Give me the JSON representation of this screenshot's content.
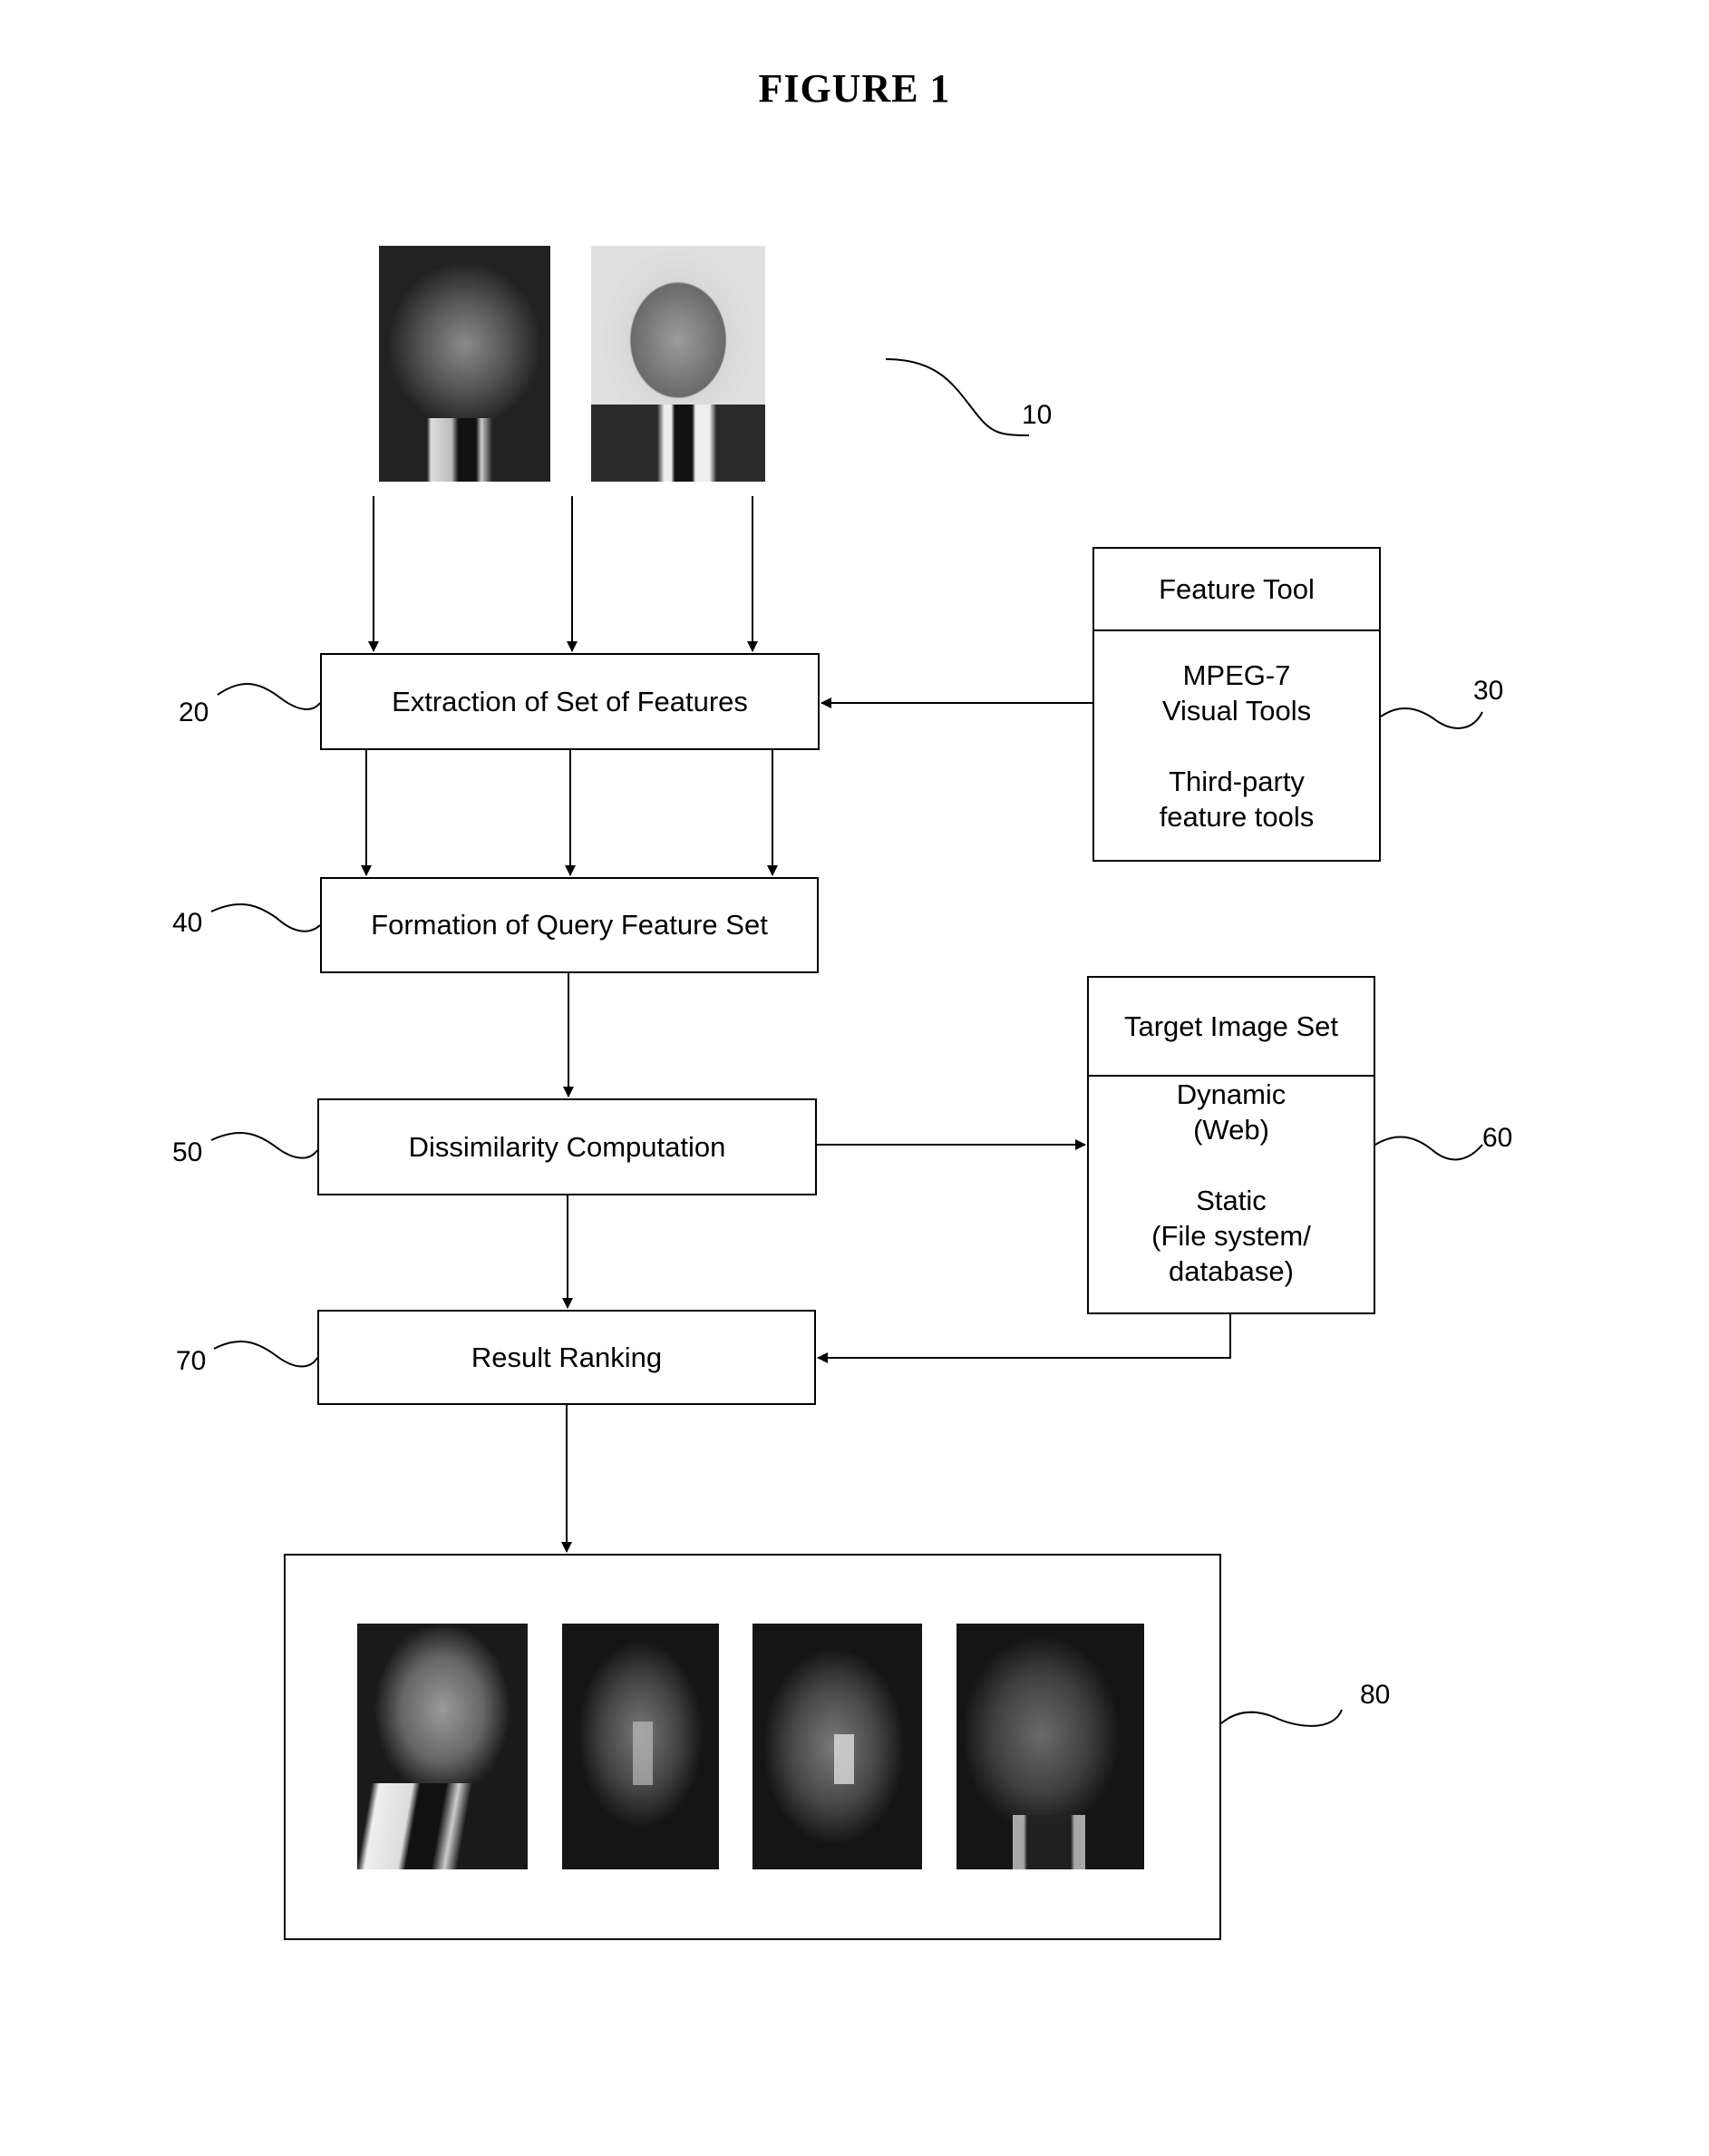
{
  "figure": {
    "title": "FIGURE 1"
  },
  "query_images": {
    "ref": "10",
    "images": [
      {
        "description": "query-face-photo-1",
        "tone": "dark"
      },
      {
        "description": "query-face-photo-2",
        "tone": "light"
      }
    ]
  },
  "steps": {
    "extraction": {
      "ref": "20",
      "label": "Extraction of Set of Features"
    },
    "formation": {
      "ref": "40",
      "label": "Formation of Query Feature Set"
    },
    "dissimilarity": {
      "ref": "50",
      "label": "Dissimilarity Computation"
    },
    "ranking": {
      "ref": "70",
      "label": "Result Ranking"
    }
  },
  "feature_tool": {
    "ref": "30",
    "header": "Feature Tool",
    "lines": [
      "MPEG-7",
      "Visual Tools",
      "",
      "Third-party",
      "feature tools"
    ]
  },
  "target_image_set": {
    "ref": "60",
    "header": "Target Image Set",
    "lines": [
      "Dynamic",
      "(Web)",
      "",
      "Static",
      "(File system/",
      "database)"
    ]
  },
  "results": {
    "ref": "80",
    "images": [
      {
        "description": "result-face-photo-1"
      },
      {
        "description": "result-face-photo-2"
      },
      {
        "description": "result-face-photo-3"
      },
      {
        "description": "result-face-photo-4"
      }
    ]
  }
}
